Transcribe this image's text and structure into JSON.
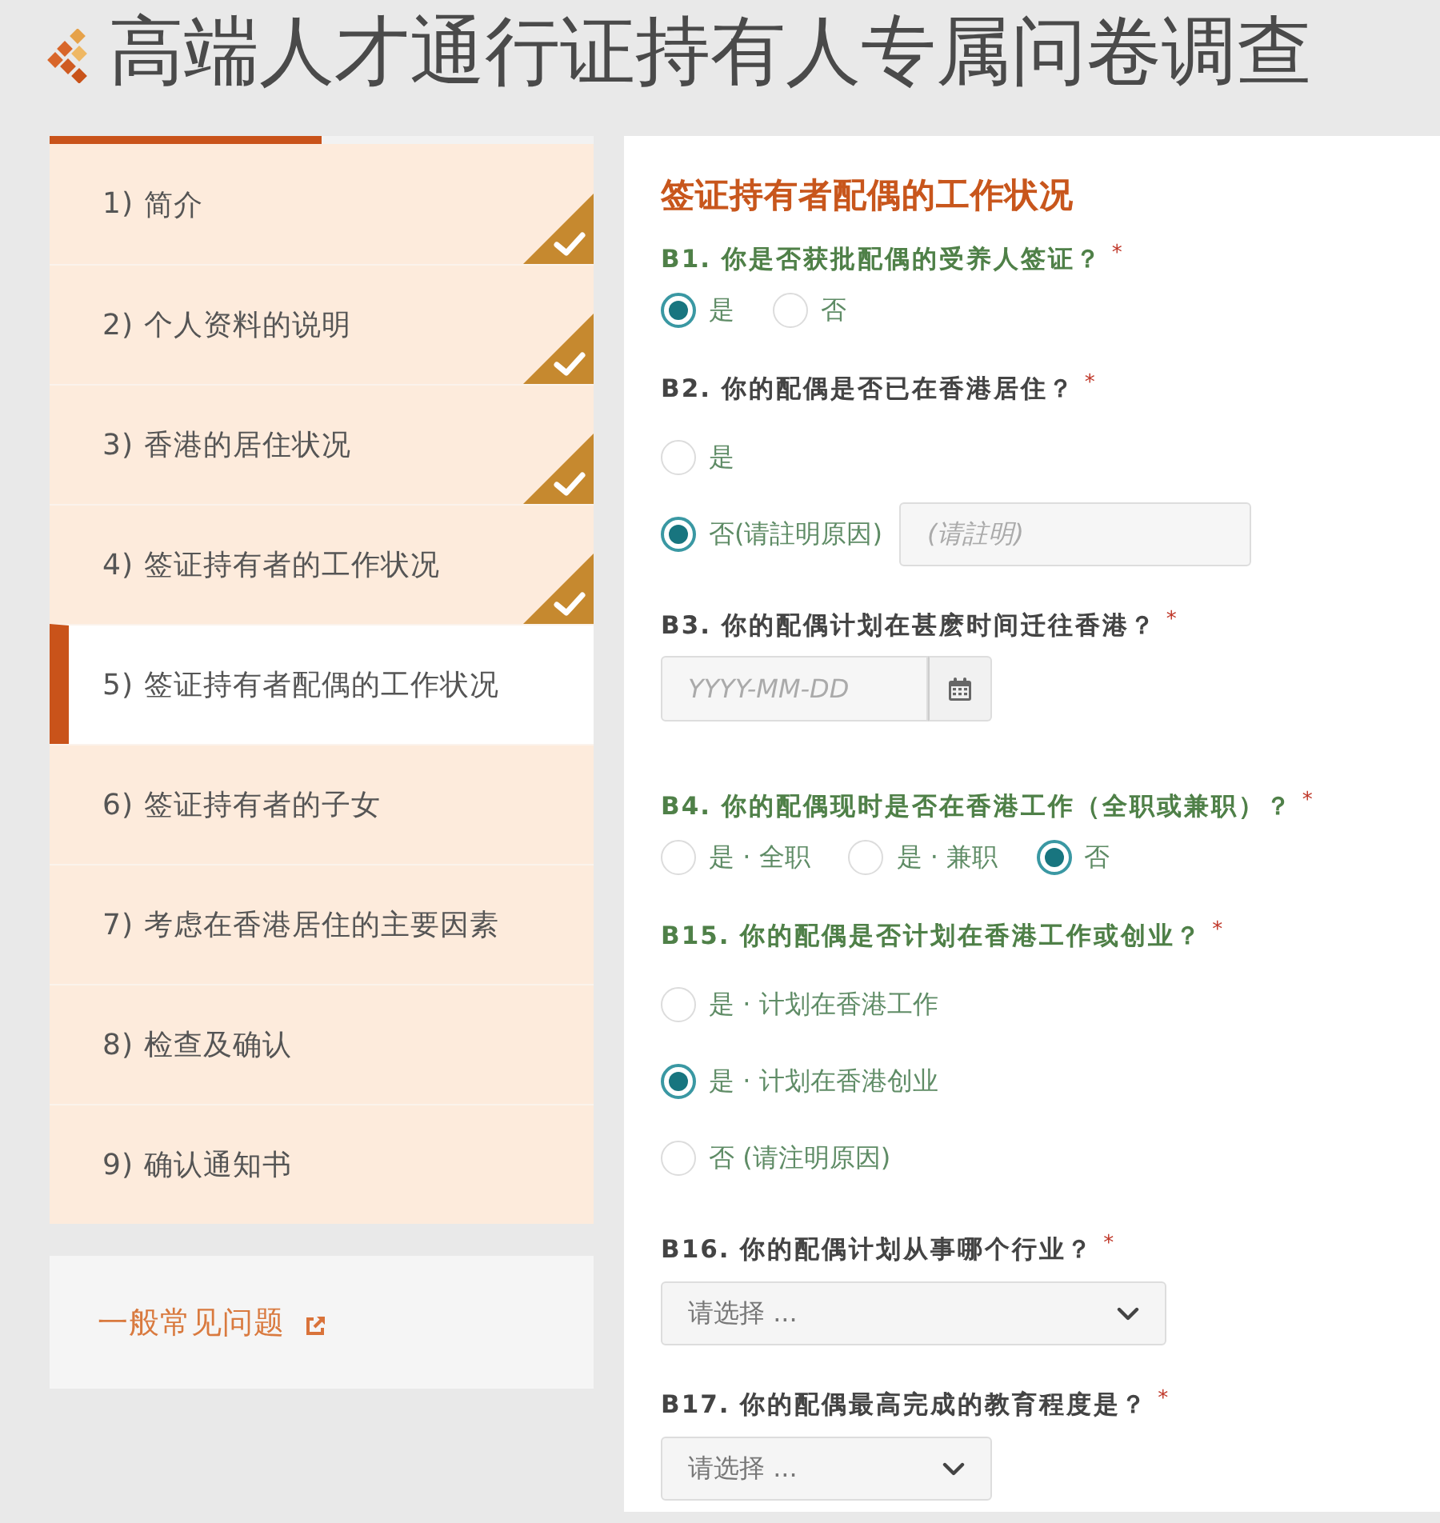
{
  "header": {
    "title": "高端人才通行证持有人专属问卷调查"
  },
  "progress": {
    "level": 0.5
  },
  "steps": [
    {
      "number": "1)",
      "title": "简介",
      "done": true,
      "selected": false
    },
    {
      "number": "2)",
      "title": "个人资料的说明",
      "done": true,
      "selected": false
    },
    {
      "number": "3)",
      "title": "香港的居住状况",
      "done": true,
      "selected": false
    },
    {
      "number": "4)",
      "title": "签证持有者的工作状况",
      "done": true,
      "selected": false
    },
    {
      "number": "5)",
      "title": "签证持有者配偶的工作状况",
      "done": false,
      "selected": true
    },
    {
      "number": "6)",
      "title": "签证持有者的子女",
      "done": false,
      "selected": false
    },
    {
      "number": "7)",
      "title": "考虑在香港居住的主要因素",
      "done": false,
      "selected": false
    },
    {
      "number": "8)",
      "title": "检查及确认",
      "done": false,
      "selected": false
    },
    {
      "number": "9)",
      "title": "确认通知书",
      "done": false,
      "selected": false
    }
  ],
  "faq_link": {
    "label": "一般常见问题"
  },
  "form": {
    "heading": "签证持有者配偶的工作状况",
    "questions": [
      {
        "kind": "radiorow",
        "label": "B1. 你是否获批配偶的受养人签证？",
        "required_mark": "*",
        "highlighted": true,
        "options": [
          {
            "label": "是",
            "selected": true
          },
          {
            "label": "否",
            "selected": false
          }
        ]
      },
      {
        "kind": "radiolist",
        "label": "B2. 你的配偶是否已在香港居住？",
        "required_mark": "*",
        "highlighted": false,
        "options": [
          {
            "label": "是",
            "selected": false
          },
          {
            "label": "否(请註明原因)",
            "selected": true,
            "field": {
              "placeholder": "(请註明)"
            }
          }
        ]
      },
      {
        "kind": "date",
        "label": "B3. 你的配偶计划在甚麽时间迁往香港？",
        "required_mark": "*",
        "highlighted": false,
        "placeholder": "YYYY-MM-DD"
      },
      {
        "kind": "radiorow",
        "label": "B4. 你的配偶现时是否在香港工作（全职或兼职）？",
        "required_mark": "*",
        "highlighted": true,
        "options": [
          {
            "label": "是 · 全职",
            "selected": false
          },
          {
            "label": "是 · 兼职",
            "selected": false
          },
          {
            "label": "否",
            "selected": true
          }
        ]
      },
      {
        "kind": "radiolist",
        "label": "B15. 你的配偶是否计划在香港工作或创业？",
        "required_mark": "*",
        "highlighted": true,
        "options": [
          {
            "label": "是 · 计划在香港工作",
            "selected": false
          },
          {
            "label": "是 · 计划在香港创业",
            "selected": true
          },
          {
            "label": "否 (请注明原因)",
            "selected": false
          }
        ]
      },
      {
        "kind": "select",
        "label": "B16. 你的配偶计划从事哪个行业？",
        "required_mark": "*",
        "highlighted": false,
        "placeholder": "请选择 ..."
      },
      {
        "kind": "select",
        "label": "B17. 你的配偶最高完成的教育程度是？",
        "required_mark": "*",
        "highlighted": false,
        "placeholder": "请选择 ..."
      }
    ]
  }
}
